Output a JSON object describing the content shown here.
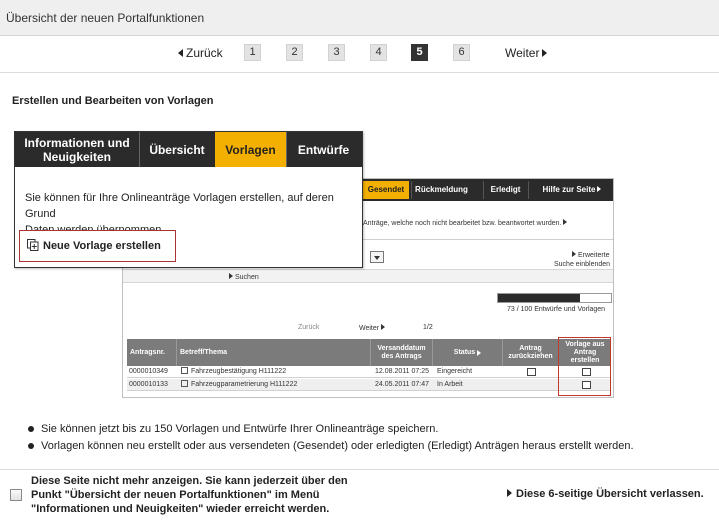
{
  "header": {
    "title": "Übersicht der neuen Portalfunktionen"
  },
  "pager": {
    "prev": "Zurück",
    "next": "Weiter",
    "pages": [
      "1",
      "2",
      "3",
      "4",
      "5",
      "6"
    ],
    "current": "5"
  },
  "section_title": "Erstellen und Bearbeiten von Vorlagen",
  "popup": {
    "tabs": [
      "Informationen und Neuigkeiten",
      "Übersicht",
      "Vorlagen",
      "Entwürfe"
    ],
    "active_tab": "Vorlagen",
    "text_line1": "Sie können für Ihre Onlineanträge Vorlagen erstellen, auf deren Grund",
    "text_line2": "Daten werden übernommen.",
    "button_label": "Neue Vorlage erstellen"
  },
  "screenshot": {
    "tabs": [
      "Gesendet",
      "Rückmeldung",
      "Erledigt",
      "Hilfe zur Seite"
    ],
    "info_text": "Anträge, welche noch nicht bearbeitet bzw. beantwortet wurden.",
    "advanced_search_1": "Erweiterte",
    "advanced_search_2": "Suche einblenden",
    "search_label": "Suchen",
    "progress_text": "73 / 100 Entwürfe und Vorlagen",
    "progress_fraction": 0.73,
    "pager_prev": "Zurück",
    "pager_next": "Weiter",
    "pager_count": "1/2",
    "columns": [
      "Antragsnr.",
      "Betreff/Thema",
      "Versanddatum des Antrags",
      "Status",
      "Antrag zurückziehen",
      "Vorlage aus Antrag erstellen"
    ],
    "rows": [
      {
        "nr": "0000010349",
        "betreff": "Fahrzeugbestätigung H111222",
        "datum": "12.08.2011 07:25",
        "status": "Eingereicht"
      },
      {
        "nr": "0000010133",
        "betreff": "Fahrzeugparametrierung H111222",
        "datum": "24.05.2011 07:47",
        "status": "In Arbeit"
      }
    ]
  },
  "bullets": [
    "Sie können jetzt bis zu 150 Vorlagen und Entwürfe Ihrer Onlineanträge speichern.",
    "Vorlagen können neu erstellt oder aus versendeten (Gesendet) oder erledigten (Erledigt) Anträgen heraus erstellt werden."
  ],
  "footer": {
    "line1": "Diese Seite nicht mehr anzeigen. Sie kann jederzeit über den",
    "line2": "Punkt \"Übersicht der neuen Portalfunktionen\" im Menü",
    "line3": "\"Informationen und Neuigkeiten\" wieder erreicht werden.",
    "leave_link": "Diese 6-seitige Übersicht verlassen."
  },
  "colors": {
    "accent": "#f4b000",
    "nav": "#2b2b2b",
    "highlight": "#c0392b"
  }
}
